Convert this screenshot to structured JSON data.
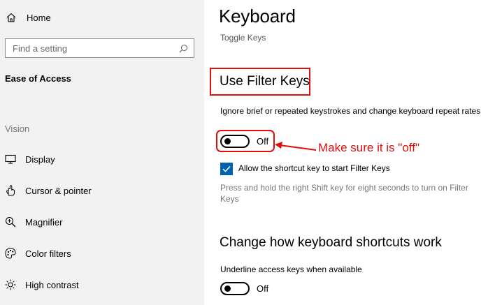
{
  "sidebar": {
    "home_label": "Home",
    "search_placeholder": "Find a setting",
    "section_title": "Ease of Access",
    "group_title": "Vision",
    "items": [
      {
        "label": "Display",
        "icon": "monitor-icon"
      },
      {
        "label": "Cursor & pointer",
        "icon": "pointer-icon"
      },
      {
        "label": "Magnifier",
        "icon": "magnifier-icon"
      },
      {
        "label": "Color filters",
        "icon": "palette-icon"
      },
      {
        "label": "High contrast",
        "icon": "brightness-icon"
      }
    ]
  },
  "main": {
    "title": "Keyboard",
    "subtitle": "Toggle Keys",
    "filter_keys": {
      "title": "Use Filter Keys",
      "description": "Ignore brief or repeated keystrokes and change keyboard repeat rates",
      "toggle_state": "Off",
      "checkbox_label": "Allow the shortcut key to start Filter Keys",
      "checkbox_checked": true,
      "hint": "Press and hold the right Shift key for eight seconds to turn on Filter Keys"
    },
    "shortcuts": {
      "title": "Change how keyboard shortcuts work",
      "underline_label": "Underline access keys when available",
      "toggle_state": "Off"
    },
    "annotation": "Make sure it is \"off\""
  },
  "colors": {
    "sidebar_bg": "#f2f2f2",
    "accent": "#0063b1",
    "annotation_red": "#e00d0d"
  }
}
